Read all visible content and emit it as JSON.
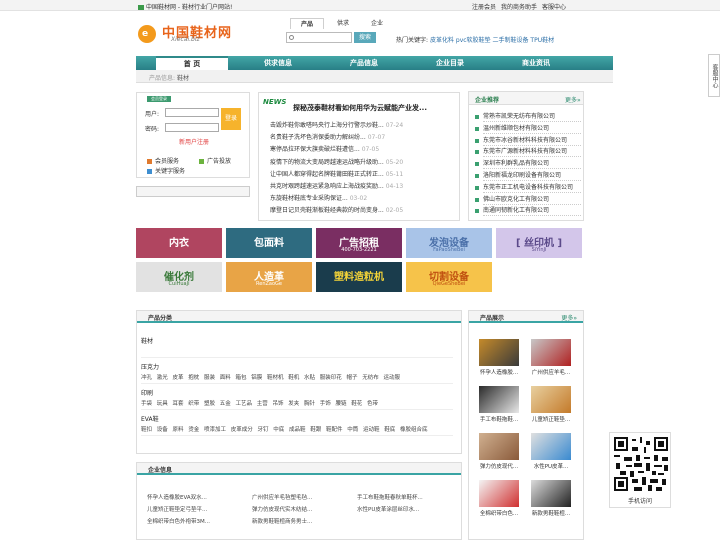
{
  "topbar": {
    "left": "中国鞋材网 - 鞋材行业门户网站!",
    "links": [
      "注册会员",
      "我的商务助手",
      "客服中心"
    ]
  },
  "logo": {
    "name": "中国鞋材网",
    "sub": "Xiecai.biz",
    "mark": "e"
  },
  "search": {
    "tabs": [
      "产品",
      "供求",
      "企业"
    ],
    "button": "搜索",
    "hot_label": "热门关键字:",
    "hot": [
      "皮革化料",
      "pvc软胶鞋垫",
      "二手制鞋设备",
      "TPU鞋材"
    ]
  },
  "nav": {
    "items": [
      "首 页",
      "供求信息",
      "产品信息",
      "企业目录",
      "商业资讯"
    ],
    "sub_label": "产品信息:",
    "sub_value": "鞋材"
  },
  "login": {
    "badge": "会员登录",
    "user_label": "用户:",
    "pass_label": "密码:",
    "submit": "登录",
    "register": "新用户注册",
    "services": [
      "会员服务",
      "广告投放",
      "关键字服务"
    ]
  },
  "news": {
    "badge": "NEWS",
    "headline": "探秘茂泰鞋材看如何用华为云赋能产业发...",
    "items": [
      {
        "t": "击毁炸鞋你敢嗒吗央行上海分行警示炒鞋...",
        "d": "07-24"
      },
      {
        "t": "名贵鞋子洗坏色消保委助力解纠纷...",
        "d": "07-07"
      },
      {
        "t": "寒停品拉环保大旗卖破烂鞋遭信...",
        "d": "07-05"
      },
      {
        "t": "疫情下的物流大变局跨越速运战略升级助...",
        "d": "05-20"
      },
      {
        "t": "让中国人都穿得起名牌鞋莆田鞋正式转正...",
        "d": "05-11"
      },
      {
        "t": "共克时艰跨越速运紧急响应上海战疫奖励...",
        "d": "04-13"
      },
      {
        "t": "东旋鞋材鞋底专业采购保证...",
        "d": "03-02"
      },
      {
        "t": "摩登日记贝壳鞋渐板鞋经典款的时尚变身...",
        "d": "02-05"
      }
    ]
  },
  "recommend": {
    "title": "企业推荐",
    "more": "更多»",
    "items": [
      "常熟市凯荣无纺布有限公司",
      "温州新维顺包材有限公司",
      "东莞市冰谷新材料科技有限公司",
      "东莞市广源新材料科技有限公司",
      "深圳市利群乳品有限公司",
      "洛阳新福龙印刷设备有限公司",
      "东莞市正工机电设备科技有限公司",
      "佛山市欧克化工有限公司",
      "南通同韧新化工有限公司"
    ]
  },
  "ads": [
    {
      "t": "内衣",
      "s": "",
      "bg": "#b04560",
      "fg": "#ffffff"
    },
    {
      "t": "包面料",
      "s": "",
      "bg": "#2e6b80",
      "fg": "#ffffff"
    },
    {
      "t": "广告招租",
      "s": "400-703-2221",
      "bg": "#7a2e62",
      "fg": "#ffffff"
    },
    {
      "t": "发泡设备",
      "s": "FaPaoSheBei",
      "bg": "#a9c4e8",
      "fg": "#4a6fa8"
    },
    {
      "t": "[ 丝印机 ]",
      "s": "SiYinJi",
      "bg": "#d3c6ea",
      "fg": "#5b4a8a"
    },
    {
      "t": "催化剂",
      "s": "CuiHuaJi",
      "bg": "#e2e2e2",
      "fg": "#3a7a3a"
    },
    {
      "t": "人造革",
      "s": "RenZaoGe",
      "bg": "#e8a446",
      "fg": "#ffffff"
    },
    {
      "t": "塑料造粒机",
      "s": "",
      "bg": "#1a3c4c",
      "fg": "#f4d438"
    },
    {
      "t": "切割设备",
      "s": "QieGeSheBei",
      "bg": "#f6c34a",
      "fg": "#c05010"
    }
  ],
  "categories": {
    "title": "产品分类",
    "groups": [
      {
        "name": "鞋材",
        "subs": ""
      },
      {
        "name": "压克力",
        "subs": "冲孔 激光 皮革 抱枕 服装 面料 箱包 铝膜 鞋材机 鞋机 水贴 服装印花 帽子 无纺布 运动服"
      },
      {
        "name": "印刷",
        "subs": "手袋 玩具 耳套 织带 塑胶 五金 工艺品 主营 吊饰 发夹 胸针 手饰 腰链 鞋花 色带"
      },
      {
        "name": "EVA鞋",
        "subs": "鞋扣 设备 原料 烫金 喷漆加工 皮革成分 牙钉 中底 成品鞋 鞋跟 鞋配件 中筒 运动鞋 鞋底 橡胶组合底"
      }
    ]
  },
  "enterprise": {
    "title": "企业信息",
    "items": [
      "怀孕人造橡胶EVA双水...",
      "广州供应羊毛毡塑毛毡...",
      "手工布鞋拖鞋春秋单鞋杯...",
      "儿童矫正鞋垫定弓垫平...",
      "弹力仿皮现代实木纺结...",
      "水性PU皮革涂层丝印水...",
      "全棉织带白色外袍带3M...",
      "新款男鞋鞋楦商务男士..."
    ]
  },
  "products": {
    "title": "产品展示",
    "more": "更多»",
    "items": [
      "怀孕人造橡胶...",
      "广州供应羊毛...",
      "手工布鞋拖鞋...",
      "儿童矫正鞋垫...",
      "弹力仿皮现代...",
      "水性PU皮革...",
      "全棉织带白色...",
      "新款男鞋鞋楦..."
    ]
  },
  "side": {
    "service": "客服中心",
    "qr_label": "手机访问"
  }
}
